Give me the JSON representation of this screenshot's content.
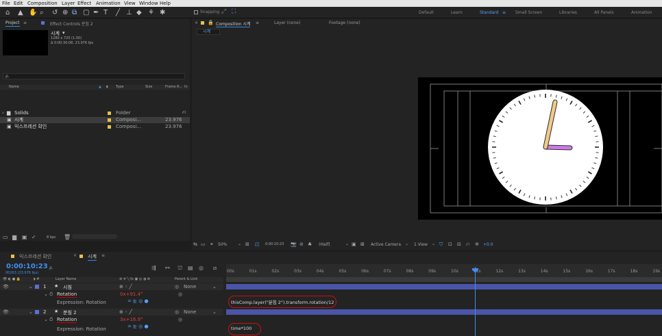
{
  "menu": [
    "File",
    "Edit",
    "Composition",
    "Layer",
    "Effect",
    "Animation",
    "View",
    "Window",
    "Help"
  ],
  "toolbar": {
    "snapping_label": "Snapping",
    "workspaces": [
      "Default",
      "Learn",
      "Standard",
      "Small Screen",
      "Libraries",
      "All Panels",
      "Animation"
    ],
    "active_workspace": "Standard"
  },
  "project": {
    "tab_label": "Project",
    "effect_controls_label": "Effect Controls 분침 2",
    "item_name": "시계",
    "item_info1": "1280 x 720 (1.00)",
    "item_info2": "Δ 0:00:30:08, 23.976 fps",
    "search_placeholder": "ρ.",
    "columns": [
      "Name",
      "Type",
      "Size",
      "Frame R...",
      "In"
    ],
    "items": [
      {
        "name": "Solids",
        "type": "Folder",
        "fps": "",
        "color": "#e8c04a",
        "icon": "folder-icon",
        "selected": false
      },
      {
        "name": "시계",
        "type": "Composi...",
        "fps": "23.976",
        "color": "#e8c04a",
        "icon": "composition-icon",
        "selected": true
      },
      {
        "name": "익스프레션 확인",
        "type": "Composi...",
        "fps": "23.976",
        "color": "#e8c04a",
        "icon": "composition-icon",
        "selected": false
      }
    ],
    "bpc": "8 bpc"
  },
  "viewer": {
    "tab_comp": "Composition 시계",
    "tab_layer": "Layer (none)",
    "tab_footage": "Footage (none)",
    "breadcrumb": "시계",
    "zoom": "50%",
    "timecode": "0:00:10:23",
    "resolution": "(Half)",
    "camera": "Active Camera",
    "view": "1 View",
    "exposure": "+0.0"
  },
  "timeline": {
    "tabs": [
      "익스프레션 확인",
      "시계"
    ],
    "active_tab": "시계",
    "timecode": "0:00:10:23",
    "frame_info": "00263 (23.976 fps)",
    "search_placeholder": "ρ.",
    "col_layer_name": "Layer Name",
    "col_parent": "Parent & Link",
    "ruler": [
      "00s",
      "01s",
      "02s",
      "03s",
      "04s",
      "05s",
      "06s",
      "07s",
      "08s",
      "09s",
      "10s",
      "11s",
      "12s",
      "13s",
      "14s",
      "15s",
      "16s",
      "17s",
      "18s",
      "19s"
    ],
    "playhead_sec": 10.95,
    "layers": [
      {
        "num": "1",
        "name": "시침",
        "parent": "None",
        "prop": "Rotation",
        "value": "0x+91.4°",
        "expr_label": "Expression: Rotation",
        "expression": "thisComp.layer(\"분침 2\").transform.rotation/12"
      },
      {
        "num": "2",
        "name": "분침 2",
        "parent": "None",
        "prop": "Rotation",
        "value": "3x+16.9°",
        "expr_label": "Expression: Rotation",
        "expression": "time*100"
      }
    ]
  }
}
